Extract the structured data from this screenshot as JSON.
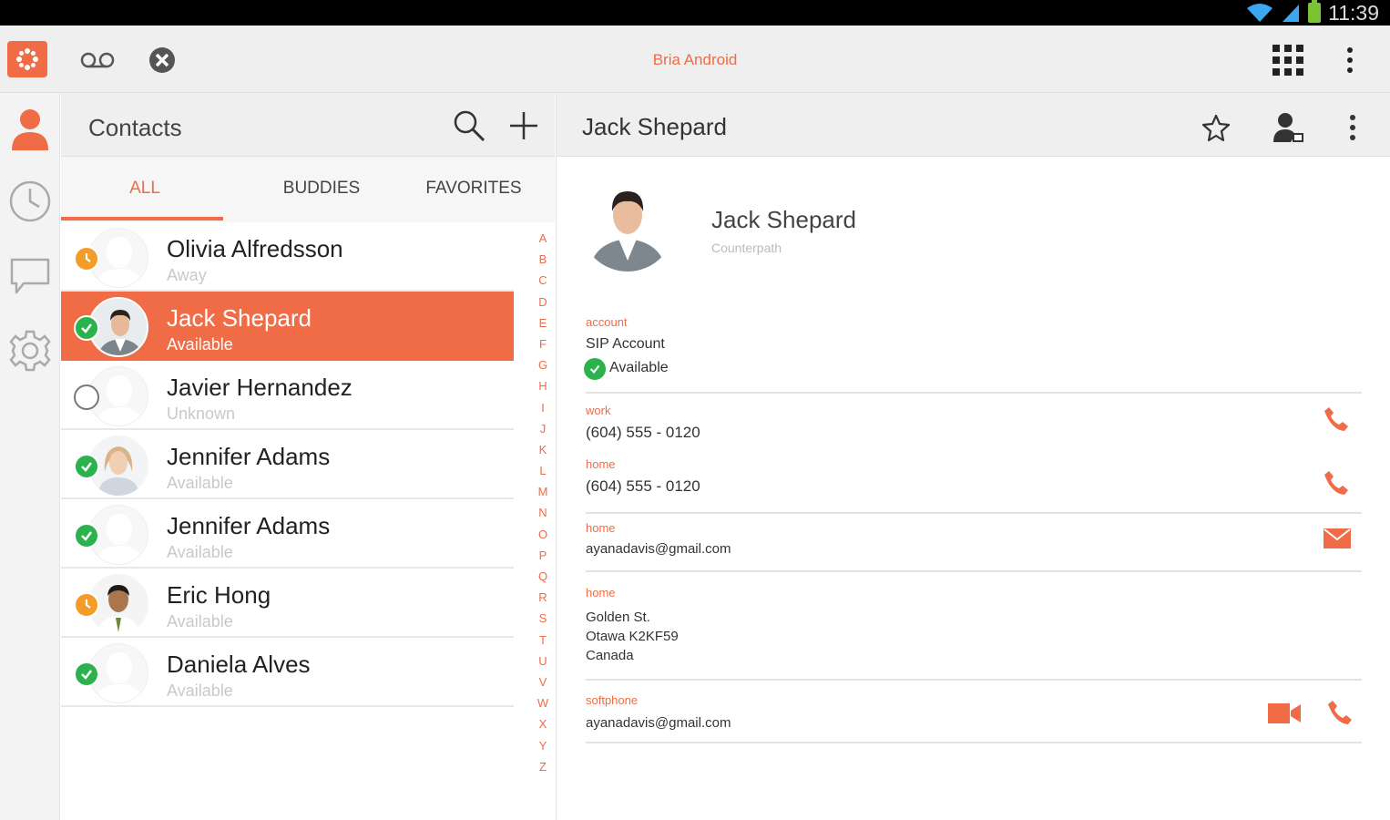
{
  "status_bar": {
    "time": "11:39"
  },
  "app": {
    "title": "Bria Android",
    "accent": "#ef6c46"
  },
  "action_bar": {
    "icons": [
      "app-logo-icon",
      "voicemail-icon",
      "close-circle-icon",
      "grid-icon",
      "overflow-menu-icon"
    ]
  },
  "rail": {
    "items": [
      "contacts-icon",
      "history-icon",
      "chat-icon",
      "settings-icon"
    ]
  },
  "contacts": {
    "title": "Contacts",
    "tabs": [
      "ALL",
      "BUDDIES",
      "FAVORITES"
    ],
    "active_tab": "ALL",
    "list": [
      {
        "name": "Olivia Alfredsson",
        "status": "Away",
        "presence": "away"
      },
      {
        "name": "Jack Shepard",
        "status": "Available",
        "presence": "available",
        "selected": true
      },
      {
        "name": "Javier Hernandez",
        "status": "Unknown",
        "presence": "unknown"
      },
      {
        "name": "Jennifer Adams",
        "status": "Available",
        "presence": "available"
      },
      {
        "name": "Jennifer Adams",
        "status": "Available",
        "presence": "available"
      },
      {
        "name": "Eric Hong",
        "status": "Available",
        "presence": "away"
      },
      {
        "name": "Daniela Alves",
        "status": "Available",
        "presence": "available"
      }
    ],
    "alphabet": [
      "A",
      "B",
      "C",
      "D",
      "E",
      "F",
      "G",
      "H",
      "I",
      "J",
      "K",
      "L",
      "M",
      "N",
      "O",
      "P",
      "Q",
      "R",
      "S",
      "T",
      "U",
      "V",
      "W",
      "X",
      "Y",
      "Z"
    ]
  },
  "details": {
    "header_title": "Jack Shepard",
    "name": "Jack Shepard",
    "company": "Counterpath",
    "account_label": "account",
    "account_value": "SIP Account",
    "account_status": "Available",
    "work_label": "work",
    "work_phone": "(604) 555 - 0120",
    "home_phone_label": "home",
    "home_phone": "(604) 555 - 0120",
    "home_email_label": "home",
    "home_email": "ayanadavis@gmail.com",
    "home_address_label": "home",
    "address_line1": "Golden St.",
    "address_line2": "Otawa K2KF59",
    "address_line3": "Canada",
    "softphone_label": "softphone",
    "softphone_value": "ayanadavis@gmail.com"
  }
}
